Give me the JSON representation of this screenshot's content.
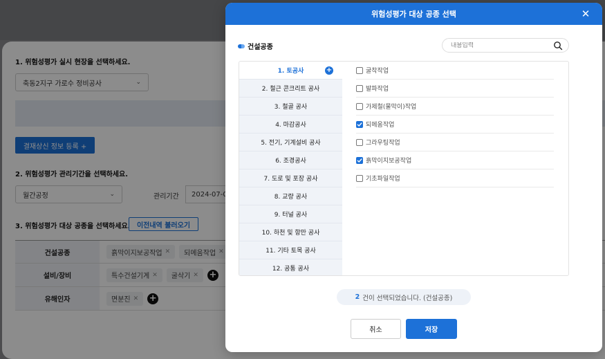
{
  "background": {
    "step1_label": "1. 위험성평가 실시 현장을 선택하세요.",
    "site_select_value": "축동2지구 가로수 정비공사",
    "payment_button": "결재상신 정보 등록 +",
    "step2_label": "2. 위험성평가 관리기간을 선택하세요.",
    "period_select_value": "월간공정",
    "period_label": "관리기간",
    "period_date": "2024-07-0",
    "step3_label": "3. 위험성평가 대상 공종을 선택하세요.",
    "load_history_button": "이전내역 불러오기",
    "table": [
      {
        "head": "건설공종",
        "tags": [
          "흙막이지보공작업",
          "되메움작업"
        ],
        "plus": false
      },
      {
        "head": "설비/장비",
        "tags": [
          "특수건설기계",
          "굴삭기"
        ],
        "plus": true
      },
      {
        "head": "유해인자",
        "tags": [
          "면분진"
        ],
        "plus": true
      }
    ]
  },
  "modal": {
    "title": "위험성평가 대상 공종 선택",
    "close": "✕",
    "section_label": "건설공종",
    "search_placeholder": "내용입력",
    "categories": [
      "1. 토공사",
      "2. 철근 콘크리트 공사",
      "3. 철골 공사",
      "4. 마감공사",
      "5. 전기, 기계설비 공사",
      "6. 조경공사",
      "7. 도로 및 포장 공사",
      "8. 교량 공사",
      "9. 터널 공사",
      "10. 하천 및 항만 공사",
      "11. 기타 토목 공사",
      "12. 공통 공사"
    ],
    "active_category_index": 0,
    "work_items": [
      {
        "label": "굴착작업",
        "checked": false
      },
      {
        "label": "발파작업",
        "checked": false
      },
      {
        "label": "가제철(물막이)작업",
        "checked": false
      },
      {
        "label": "되메움작업",
        "checked": true
      },
      {
        "label": "그라우팅작업",
        "checked": false
      },
      {
        "label": "흙막이지보공작업",
        "checked": true
      },
      {
        "label": "기초파일작업",
        "checked": false
      }
    ],
    "summary_count": "2",
    "summary_text": "건이 선택되었습니다. (건설공종)",
    "cancel_label": "취소",
    "save_label": "저장"
  },
  "colors": {
    "accent": "#1d71d8"
  }
}
